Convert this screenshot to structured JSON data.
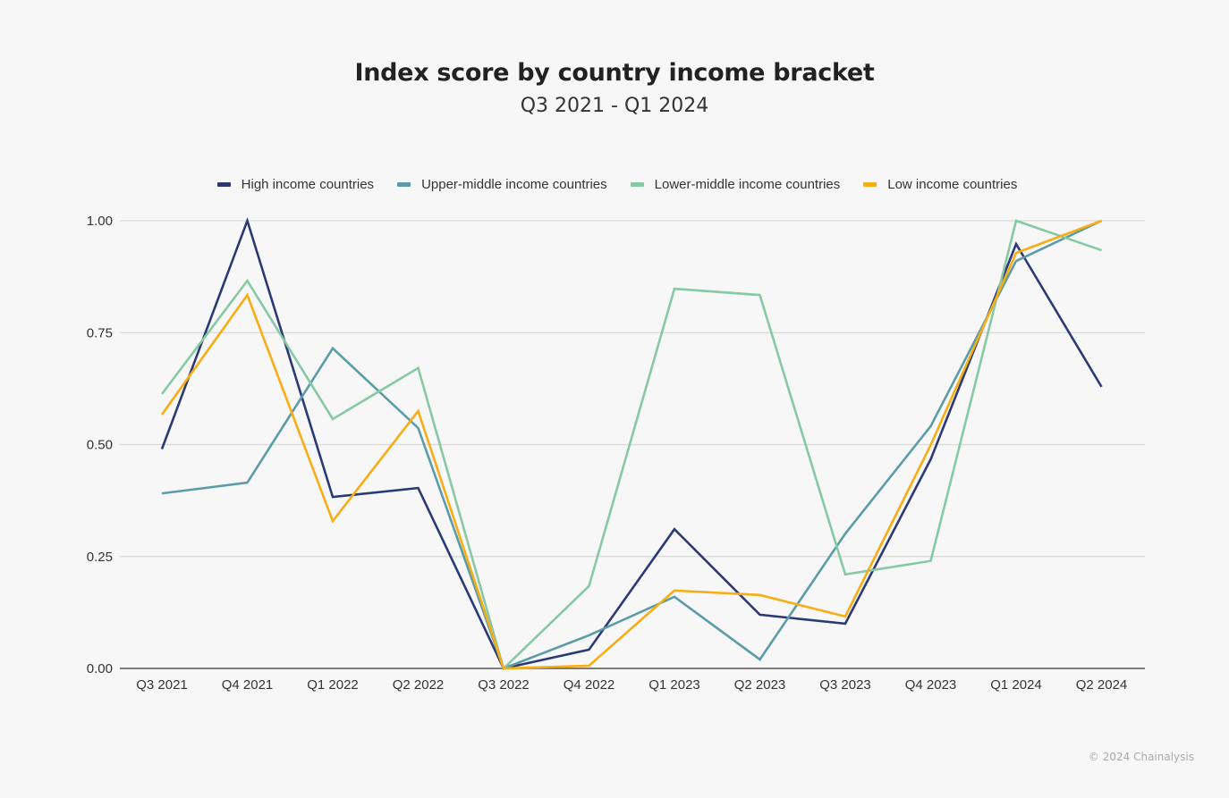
{
  "chart_data": {
    "type": "line",
    "title": "Index score by country income bracket",
    "subtitle": "Q3 2021 - Q1 2024",
    "xlabel": "",
    "ylabel": "",
    "ylim": [
      0,
      1
    ],
    "yticks": [
      "0.00",
      "0.25",
      "0.50",
      "0.75",
      "1.00"
    ],
    "ytick_values": [
      0,
      0.25,
      0.5,
      0.75,
      1.0
    ],
    "grid": true,
    "legend_position": "top-center",
    "categories": [
      "Q3 2021",
      "Q4 2021",
      "Q1 2022",
      "Q2 2022",
      "Q3 2022",
      "Q4 2022",
      "Q1 2023",
      "Q2 2023",
      "Q3 2023",
      "Q4 2023",
      "Q1 2024",
      "Q2 2024"
    ],
    "series": [
      {
        "name": "High income countries",
        "color": "#2b3a76",
        "values": [
          0.49,
          1.0,
          0.383,
          0.403,
          0.0,
          0.042,
          0.311,
          0.12,
          0.1,
          0.467,
          0.948,
          0.629
        ]
      },
      {
        "name": "Upper-middle income countries",
        "color": "#5b9ca8",
        "values": [
          0.391,
          0.415,
          0.715,
          0.537,
          0.0,
          0.074,
          0.16,
          0.02,
          0.301,
          0.541,
          0.91,
          1.0
        ]
      },
      {
        "name": "Lower-middle income countries",
        "color": "#86c9a4",
        "values": [
          0.613,
          0.866,
          0.557,
          0.671,
          0.0,
          0.184,
          0.848,
          0.834,
          0.21,
          0.24,
          1.0,
          0.934
        ]
      },
      {
        "name": "Low income countries",
        "color": "#f9ad14",
        "values": [
          0.567,
          0.834,
          0.329,
          0.575,
          0.0,
          0.006,
          0.174,
          0.164,
          0.116,
          0.499,
          0.928,
          1.0
        ]
      }
    ]
  },
  "footer": {
    "copyright": "© 2024 Chainalysis"
  }
}
